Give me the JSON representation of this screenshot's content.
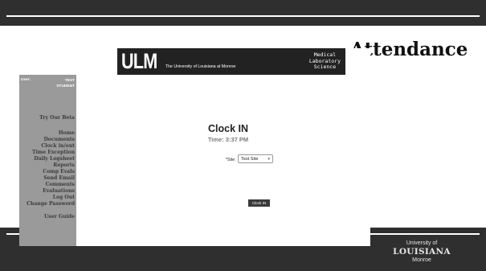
{
  "slide": {
    "title": "Attendance",
    "footer_logo": {
      "line1": "University of",
      "line2": "LOUISIANA",
      "line3": "Monroe"
    }
  },
  "banner": {
    "logo_text": "ULM",
    "university": "The University of Louisiana at Monroe",
    "program": "Medical\nLaboratory\nScience"
  },
  "user": {
    "label": "User:",
    "name_line1": "TEST",
    "name_line2": "STUDENT"
  },
  "nav": {
    "try_beta": "Try Our Beta",
    "items": [
      "Home",
      "Documents",
      "Clock in/out",
      "Time Exception",
      "Daily Logsheet",
      "Reports",
      "Comp Evals",
      "Send Email",
      "Comments",
      "Evaluations",
      "Log Out",
      "Change Password"
    ],
    "user_guide": "User Guide"
  },
  "clock": {
    "title": "Clock IN",
    "time": "Time: 3:37 PM",
    "site_label": "*Site:",
    "site_value": "Test Site",
    "button": "Clock IN"
  }
}
